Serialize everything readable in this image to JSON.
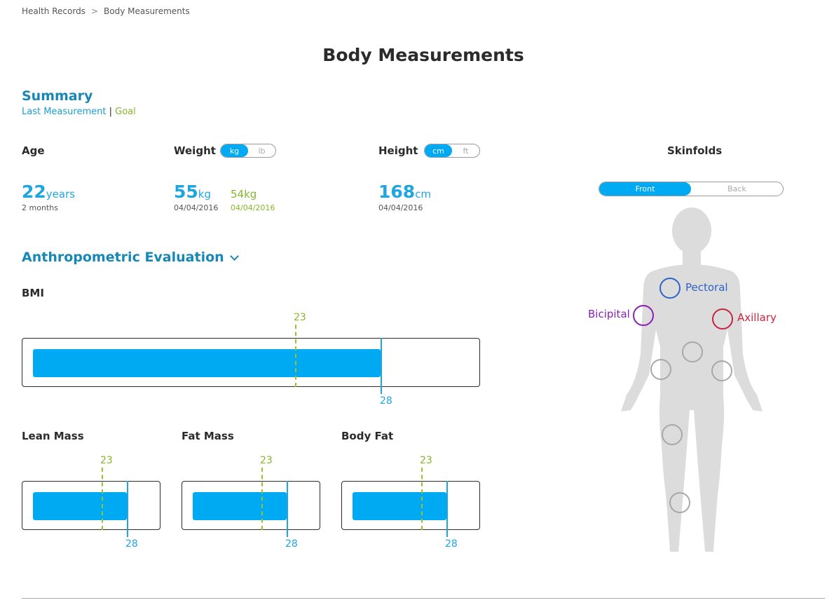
{
  "breadcrumb": {
    "items": [
      "Health Records",
      "Body Measurements"
    ],
    "separator": ">"
  },
  "page_title": "Body Measurements",
  "summary": {
    "title": "Summary",
    "legend_last": "Last Measurement",
    "legend_sep": "|",
    "legend_goal": "Goal"
  },
  "age": {
    "label": "Age",
    "value": "22",
    "unit": "years",
    "sub": "2 months"
  },
  "weight": {
    "label": "Weight",
    "units": [
      "kg",
      "lb"
    ],
    "active_unit": "kg",
    "value": "55",
    "unit": "kg",
    "date": "04/04/2016",
    "goal_value": "54kg",
    "goal_date": "04/04/2016"
  },
  "height": {
    "label": "Height",
    "units": [
      "cm",
      "ft"
    ],
    "active_unit": "cm",
    "value": "168",
    "unit": "cm",
    "date": "04/04/2016"
  },
  "anthropometric": {
    "title": "Anthropometric Evaluation"
  },
  "bmi": {
    "label": "BMI",
    "goal": "23",
    "current": "28",
    "fill_fraction": 0.77,
    "goal_fraction": 0.58
  },
  "small_gauges": [
    {
      "label": "Lean Mass",
      "goal": "23",
      "current": "28",
      "fill_fraction": 0.68,
      "goal_fraction": 0.5
    },
    {
      "label": "Fat Mass",
      "goal": "23",
      "current": "28",
      "fill_fraction": 0.68,
      "goal_fraction": 0.5
    },
    {
      "label": "Body Fat",
      "goal": "23",
      "current": "28",
      "fill_fraction": 0.68,
      "goal_fraction": 0.5
    }
  ],
  "skinfolds": {
    "title": "Skinfolds",
    "views": [
      "Front",
      "Back"
    ],
    "active_view": "Front",
    "sites": {
      "pectoral": "Pectoral",
      "bicipital": "Bicipital",
      "axillary": "Axillary"
    }
  },
  "colors": {
    "accent": "#00aaf3",
    "title_blue": "#1788b6",
    "goal_green": "#86b72a",
    "pectoral": "#2e63c7",
    "bicipital": "#8a1fb3",
    "axillary": "#c8243f",
    "body_gray": "#dcdcdc"
  }
}
